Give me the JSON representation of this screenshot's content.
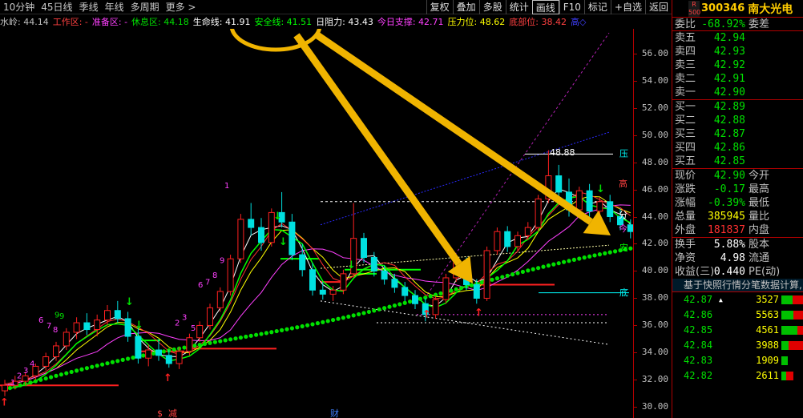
{
  "toolbar": {
    "periods": [
      "10分钟",
      "45日线",
      "季线",
      "年线",
      "多周期",
      "更多 >"
    ],
    "buttons": [
      "复权",
      "叠加",
      "多股",
      "统计",
      "画线",
      "F10",
      "标记",
      "+自选",
      "返回"
    ],
    "active_button_index": 4
  },
  "indicators": [
    {
      "label": "水岭: 44.14",
      "color": "#c0c0c0"
    },
    {
      "label": "工作区: -",
      "color": "#ff4040"
    },
    {
      "label": "准备区: -",
      "color": "#ff40ff"
    },
    {
      "label": "休息区: 44.18",
      "color": "#00e000"
    },
    {
      "label": "生命线: 41.91",
      "color": "#ffffff"
    },
    {
      "label": "安全线: 41.51",
      "color": "#00ff00"
    },
    {
      "label": "日阻力: 43.43",
      "color": "#ffffff"
    },
    {
      "label": "今日支撑: 42.71",
      "color": "#ff40ff"
    },
    {
      "label": "压力位: 48.62",
      "color": "#ffff00"
    },
    {
      "label": "底部位: 38.42",
      "color": "#ff4040"
    },
    {
      "label": "高◇",
      "color": "#4040ff"
    }
  ],
  "chart_data": {
    "type": "candlestick",
    "ylim": [
      29.2,
      57.8
    ],
    "yticks": [
      30.0,
      32.0,
      34.0,
      36.0,
      38.0,
      40.0,
      42.0,
      44.0,
      46.0,
      48.0,
      50.0,
      52.0,
      54.0,
      56.0
    ],
    "high_marker": "48.88",
    "right_labels": [
      "压",
      "高",
      "分",
      "今",
      "安",
      "底"
    ],
    "bottom_labels": [
      "$",
      "减",
      "财"
    ],
    "nine_turn_counts": [
      "1",
      "2",
      "3",
      "4",
      "6",
      "7",
      "8",
      "9",
      "1",
      "2",
      "3",
      "5",
      "6",
      "7",
      "8",
      "9"
    ],
    "candles": [
      {
        "o": 31.2,
        "h": 32.0,
        "l": 30.8,
        "c": 31.6
      },
      {
        "o": 31.6,
        "h": 32.3,
        "l": 31.3,
        "c": 31.9
      },
      {
        "o": 31.9,
        "h": 32.6,
        "l": 31.6,
        "c": 32.3
      },
      {
        "o": 32.3,
        "h": 33.2,
        "l": 32.0,
        "c": 33.0
      },
      {
        "o": 33.0,
        "h": 34.0,
        "l": 32.7,
        "c": 33.7
      },
      {
        "o": 33.7,
        "h": 34.8,
        "l": 33.4,
        "c": 34.5
      },
      {
        "o": 34.5,
        "h": 35.8,
        "l": 34.2,
        "c": 35.5
      },
      {
        "o": 35.5,
        "h": 36.6,
        "l": 35.0,
        "c": 36.2
      },
      {
        "o": 36.2,
        "h": 36.9,
        "l": 35.3,
        "c": 35.7
      },
      {
        "o": 35.7,
        "h": 36.8,
        "l": 35.2,
        "c": 36.4
      },
      {
        "o": 36.4,
        "h": 37.5,
        "l": 36.0,
        "c": 37.1
      },
      {
        "o": 37.1,
        "h": 37.8,
        "l": 36.2,
        "c": 36.5
      },
      {
        "o": 36.5,
        "h": 37.0,
        "l": 34.8,
        "c": 35.2
      },
      {
        "o": 35.2,
        "h": 35.8,
        "l": 33.2,
        "c": 33.6
      },
      {
        "o": 33.6,
        "h": 34.6,
        "l": 33.0,
        "c": 34.2
      },
      {
        "o": 34.2,
        "h": 35.0,
        "l": 33.4,
        "c": 33.8
      },
      {
        "o": 33.8,
        "h": 34.2,
        "l": 32.9,
        "c": 33.2
      },
      {
        "o": 33.2,
        "h": 34.4,
        "l": 32.8,
        "c": 34.1
      },
      {
        "o": 34.1,
        "h": 35.4,
        "l": 33.8,
        "c": 35.1
      },
      {
        "o": 35.1,
        "h": 36.3,
        "l": 34.8,
        "c": 36.0
      },
      {
        "o": 36.0,
        "h": 37.6,
        "l": 35.7,
        "c": 37.3
      },
      {
        "o": 37.3,
        "h": 38.8,
        "l": 37.0,
        "c": 38.5
      },
      {
        "o": 38.5,
        "h": 41.2,
        "l": 38.2,
        "c": 40.9
      },
      {
        "o": 40.9,
        "h": 44.2,
        "l": 40.6,
        "c": 43.8
      },
      {
        "o": 43.8,
        "h": 45.0,
        "l": 42.6,
        "c": 43.2
      },
      {
        "o": 43.2,
        "h": 43.9,
        "l": 41.5,
        "c": 42.1
      },
      {
        "o": 42.1,
        "h": 44.6,
        "l": 41.8,
        "c": 44.3
      },
      {
        "o": 44.3,
        "h": 45.8,
        "l": 43.2,
        "c": 43.6
      },
      {
        "o": 43.6,
        "h": 44.2,
        "l": 40.8,
        "c": 41.2
      },
      {
        "o": 41.2,
        "h": 42.0,
        "l": 39.6,
        "c": 40.1
      },
      {
        "o": 40.1,
        "h": 40.6,
        "l": 38.2,
        "c": 38.6
      },
      {
        "o": 38.6,
        "h": 39.2,
        "l": 37.9,
        "c": 38.3
      },
      {
        "o": 38.3,
        "h": 38.9,
        "l": 37.8,
        "c": 38.6
      },
      {
        "o": 38.6,
        "h": 40.1,
        "l": 38.3,
        "c": 39.8
      },
      {
        "o": 39.8,
        "h": 45.0,
        "l": 39.5,
        "c": 42.4
      },
      {
        "o": 42.4,
        "h": 42.8,
        "l": 40.6,
        "c": 41.0
      },
      {
        "o": 41.0,
        "h": 41.4,
        "l": 39.6,
        "c": 40.0
      },
      {
        "o": 40.0,
        "h": 40.4,
        "l": 39.0,
        "c": 39.4
      },
      {
        "o": 39.4,
        "h": 39.8,
        "l": 38.4,
        "c": 38.8
      },
      {
        "o": 38.8,
        "h": 39.2,
        "l": 37.8,
        "c": 38.2
      },
      {
        "o": 38.2,
        "h": 38.6,
        "l": 37.2,
        "c": 37.6
      },
      {
        "o": 37.6,
        "h": 38.0,
        "l": 36.3,
        "c": 36.8
      },
      {
        "o": 36.8,
        "h": 38.2,
        "l": 36.5,
        "c": 37.9
      },
      {
        "o": 37.9,
        "h": 39.8,
        "l": 37.6,
        "c": 39.5
      },
      {
        "o": 39.5,
        "h": 40.9,
        "l": 39.2,
        "c": 40.6
      },
      {
        "o": 40.6,
        "h": 41.0,
        "l": 38.6,
        "c": 39.0
      },
      {
        "o": 39.0,
        "h": 39.4,
        "l": 37.6,
        "c": 38.0
      },
      {
        "o": 38.0,
        "h": 41.8,
        "l": 37.8,
        "c": 41.5
      },
      {
        "o": 41.5,
        "h": 43.2,
        "l": 41.2,
        "c": 42.9
      },
      {
        "o": 42.9,
        "h": 43.3,
        "l": 41.4,
        "c": 41.8
      },
      {
        "o": 41.8,
        "h": 42.9,
        "l": 41.5,
        "c": 42.6
      },
      {
        "o": 42.6,
        "h": 43.6,
        "l": 42.3,
        "c": 43.2
      },
      {
        "o": 43.2,
        "h": 45.6,
        "l": 42.9,
        "c": 45.3
      },
      {
        "o": 45.3,
        "h": 48.88,
        "l": 45.0,
        "c": 47.0
      },
      {
        "o": 47.0,
        "h": 47.8,
        "l": 45.4,
        "c": 45.8
      },
      {
        "o": 45.8,
        "h": 46.8,
        "l": 44.0,
        "c": 44.5
      },
      {
        "o": 44.5,
        "h": 46.2,
        "l": 44.2,
        "c": 45.9
      },
      {
        "o": 45.9,
        "h": 46.4,
        "l": 44.0,
        "c": 44.4
      },
      {
        "o": 44.4,
        "h": 45.4,
        "l": 44.1,
        "c": 45.1
      },
      {
        "o": 45.1,
        "h": 45.6,
        "l": 43.6,
        "c": 44.0
      },
      {
        "o": 44.0,
        "h": 44.6,
        "l": 43.0,
        "c": 43.4
      },
      {
        "o": 43.4,
        "h": 43.8,
        "l": 42.4,
        "c": 42.9
      }
    ]
  },
  "stock": {
    "badge": "R\n500",
    "code": "300346",
    "name": "南大光电",
    "ratio": {
      "label": "委比",
      "value": "-68.92%",
      "label2": "委差"
    },
    "asks": [
      {
        "label": "卖五",
        "price": "42.94"
      },
      {
        "label": "卖四",
        "price": "42.93"
      },
      {
        "label": "卖三",
        "price": "42.92"
      },
      {
        "label": "卖二",
        "price": "42.91"
      },
      {
        "label": "卖一",
        "price": "42.90"
      }
    ],
    "bids": [
      {
        "label": "买一",
        "price": "42.89"
      },
      {
        "label": "买二",
        "price": "42.88"
      },
      {
        "label": "买三",
        "price": "42.87"
      },
      {
        "label": "买四",
        "price": "42.86"
      },
      {
        "label": "买五",
        "price": "42.85"
      }
    ],
    "quote": [
      {
        "label": "现价",
        "value": "42.90",
        "label2": "今开",
        "color": "#00e000"
      },
      {
        "label": "涨跌",
        "value": "-0.17",
        "label2": "最高",
        "color": "#00e000"
      },
      {
        "label": "涨幅",
        "value": "-0.39%",
        "label2": "最低",
        "color": "#00e000"
      },
      {
        "label": "总量",
        "value": "385945",
        "label2": "量比",
        "color": "#ffff00"
      },
      {
        "label": "外盘",
        "value": "181837",
        "label2": "内盘",
        "color": "#ff3030"
      }
    ],
    "quote2": [
      {
        "label": "换手",
        "value": "5.88%",
        "label2": "股本"
      },
      {
        "label": "净资",
        "value": "4.98",
        "label2": "流通"
      },
      {
        "label": "收益(三)",
        "value": "0.440",
        "label2": "PE(动)"
      }
    ],
    "note": "基于快照行情分笔数据计算,",
    "ticks": [
      {
        "price": "42.87",
        "up": true,
        "vol": "3527",
        "g": 0.45,
        "r": 0.55
      },
      {
        "price": "42.86",
        "up": false,
        "vol": "5563",
        "g": 0.5,
        "r": 0.5
      },
      {
        "price": "42.85",
        "up": false,
        "vol": "4561",
        "g": 0.65,
        "r": 0.35
      },
      {
        "price": "42.84",
        "up": false,
        "vol": "3988",
        "g": 0.3,
        "r": 0.7
      },
      {
        "price": "42.83",
        "up": false,
        "vol": "1909",
        "g": 0.25,
        "r": 0.0
      },
      {
        "price": "42.82",
        "up": false,
        "vol": "2611",
        "g": 0.2,
        "r": 0.3
      }
    ]
  }
}
